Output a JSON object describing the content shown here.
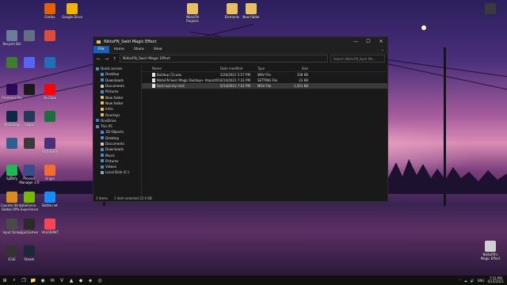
{
  "desktop": {
    "icons_left": [
      {
        "label": "Recycle Bin",
        "icon": "recycle-bin-icon",
        "color": "#6a7e9a"
      },
      {
        "label": "",
        "icon": "minecraft-icon",
        "color": "#3f7d2c"
      },
      {
        "label": "Premiere Pro",
        "icon": "premiere-icon",
        "color": "#2a0a59"
      },
      {
        "label": "Photoshop",
        "icon": "photoshop-icon",
        "color": "#0b2a44"
      },
      {
        "label": "",
        "icon": "app-icon",
        "color": "#2f5f8f"
      },
      {
        "label": "Spotify",
        "icon": "spotify-icon",
        "color": "#1db954"
      },
      {
        "label": "Counter-Strike Global Offe...",
        "icon": "csgo-icon",
        "color": "#d98c1a"
      },
      {
        "label": "Input Delay",
        "icon": "app-icon",
        "color": "#4a4a4a"
      },
      {
        "label": "iCUE",
        "icon": "icue-icon",
        "color": "#333333"
      }
    ],
    "icons_col2": [
      {
        "label": "",
        "icon": "app-icon",
        "color": "#607080"
      },
      {
        "label": "",
        "icon": "discord-icon",
        "color": "#5865f2"
      },
      {
        "label": "",
        "icon": "app-icon",
        "color": "#1a1a1a"
      },
      {
        "label": "Vegas",
        "icon": "vegas-icon",
        "color": "#233a55"
      },
      {
        "label": "",
        "icon": "app-icon",
        "color": "#3a3a3a"
      },
      {
        "label": "Process Manager 2.0",
        "icon": "process-icon",
        "color": "#3b4c8a"
      },
      {
        "label": "GeForce Experience",
        "icon": "nvidia-icon",
        "color": "#76b900"
      },
      {
        "label": "EpicGames",
        "icon": "epic-icon",
        "color": "#2a2a2a"
      },
      {
        "label": "Steam",
        "icon": "steam-icon",
        "color": "#1b2838"
      }
    ],
    "icons_col3": [
      {
        "label": "Firefox",
        "icon": "firefox-icon",
        "color": "#e66000"
      },
      {
        "label": "",
        "icon": "chrome-icon",
        "color": "#dd4b39"
      },
      {
        "label": "",
        "icon": "app-icon",
        "color": "#1d6fb8"
      },
      {
        "label": "YouTube",
        "icon": "youtube-icon",
        "color": "#ff0000"
      },
      {
        "label": "",
        "icon": "app-icon",
        "color": "#1a6f3c"
      },
      {
        "label": "FortniteFN",
        "icon": "app-icon",
        "color": "#4a2f7a"
      },
      {
        "label": "Origin",
        "icon": "origin-icon",
        "color": "#f56c2d"
      },
      {
        "label": "Battle.net",
        "icon": "battlenet-icon",
        "color": "#148eff"
      },
      {
        "label": "VALORANT",
        "icon": "valorant-icon",
        "color": "#fa4454"
      }
    ],
    "icons_top": [
      {
        "label": "Google Drive",
        "icon": "drive-icon",
        "color": "#f4b400"
      },
      {
        "label": "NiktoFN Projects",
        "icon": "folder-icon",
        "color": "#e8c060"
      },
      {
        "label": "Elements",
        "icon": "folder-icon",
        "color": "#e8c060"
      },
      {
        "label": "New folder",
        "icon": "folder-icon",
        "color": "#e8c060"
      }
    ],
    "icons_right": [
      {
        "label": "",
        "icon": "app-icon",
        "color": "#3a3a3a"
      },
      {
        "label": "NiktoFN's Magic Effect",
        "icon": "app-icon",
        "color": "#d0d0d0"
      }
    ]
  },
  "explorer": {
    "title": "NiktoFN_Swirl Magic Effect",
    "controls": [
      "—",
      "☐",
      "✕"
    ],
    "ribbon_tabs": [
      "File",
      "Home",
      "Share",
      "View"
    ],
    "nav": [
      "←",
      "→",
      "↑"
    ],
    "path": "NiktoFN_Swirl Magic Effect",
    "search_placeholder": "Search NiktoFN_Swirl Ma...",
    "sidebar": [
      {
        "label": "Quick access",
        "color": "#4a8fd4"
      },
      {
        "label": "Desktop",
        "color": "#4a8fd4"
      },
      {
        "label": "Downloads",
        "color": "#4a8fd4"
      },
      {
        "label": "Documents",
        "color": "#c9c9c9"
      },
      {
        "label": "Pictures",
        "color": "#4a8fd4"
      },
      {
        "label": "New folder",
        "color": "#e8c060"
      },
      {
        "label": "New folder",
        "color": "#e8c060"
      },
      {
        "label": "Intro",
        "color": "#e8c060"
      },
      {
        "label": "Overlays",
        "color": "#e8c060"
      },
      {
        "label": "OneDrive",
        "color": "#2d7fd4"
      },
      {
        "label": "This PC",
        "color": "#4a8fd4"
      },
      {
        "label": "3D Objects",
        "color": "#4a8fd4"
      },
      {
        "label": "Desktop",
        "color": "#4a8fd4"
      },
      {
        "label": "Documents",
        "color": "#c9c9c9"
      },
      {
        "label": "Downloads",
        "color": "#4a8fd4"
      },
      {
        "label": "Music",
        "color": "#4a8fd4"
      },
      {
        "label": "Pictures",
        "color": "#4a8fd4"
      },
      {
        "label": "Videos",
        "color": "#4a8fd4"
      },
      {
        "label": "Local Disk (C:)",
        "color": "#9aa"
      }
    ],
    "columns": [
      "Name",
      "Date modified",
      "Type",
      "Size"
    ],
    "files": [
      {
        "name": "Buildup [1].wav",
        "date": "2/26/2021 5:57 PM",
        "type": "WAV File",
        "size": "338 KB",
        "selected": false
      },
      {
        "name": "NiktoFN Swirl Magic Buildup+ Impact01...",
        "date": "6/14/2021 7:31 PM",
        "type": "SETTING File",
        "size": "23 KB",
        "selected": false
      },
      {
        "name": "Swirl out my mist",
        "date": "6/14/2021 7:41 PM",
        "type": "MGV File",
        "size": "1,501 KB",
        "selected": true
      }
    ],
    "status": [
      "3 items",
      "1 item selected  22.0 KB"
    ]
  },
  "taskbar": {
    "start": "⊞",
    "search": "⌕",
    "taskview": "❐",
    "apps": [
      "📁",
      "◉",
      "✉",
      "V",
      "▲",
      "◆",
      "◈",
      "◎"
    ],
    "tray": [
      "˄",
      "☁",
      "🔊",
      "ENG"
    ],
    "time": "7:52 PM",
    "date": "6/14/2021"
  }
}
